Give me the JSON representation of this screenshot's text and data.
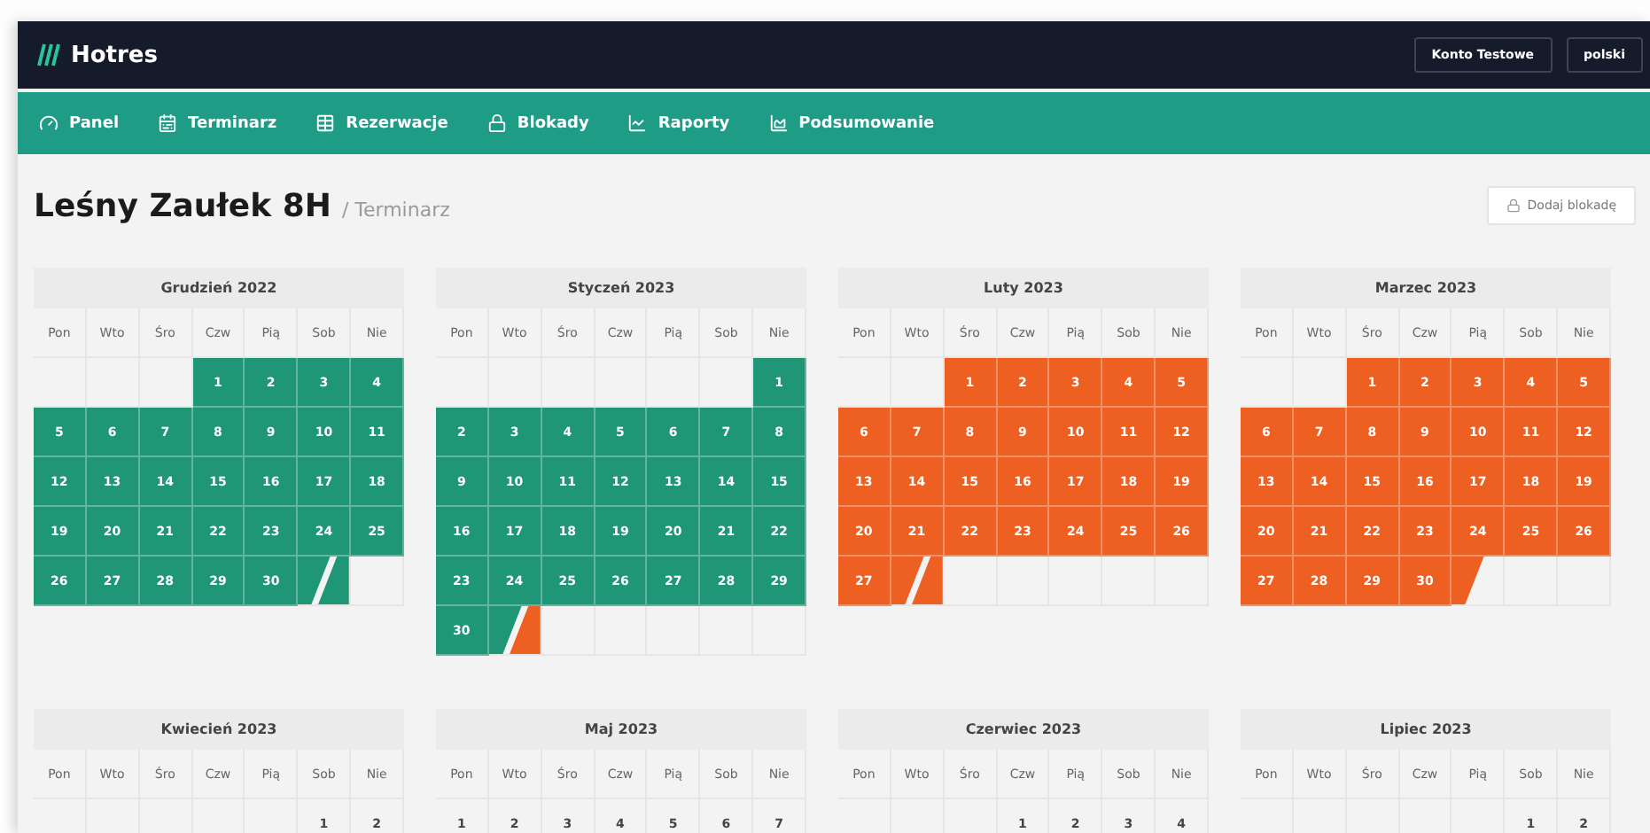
{
  "app": {
    "logo": "Hotres",
    "account_button": "Konto Testowe",
    "language_button": "polski"
  },
  "nav": [
    {
      "label": "Panel"
    },
    {
      "label": "Terminarz"
    },
    {
      "label": "Rezerwacje"
    },
    {
      "label": "Blokady"
    },
    {
      "label": "Raporty"
    },
    {
      "label": "Podsumowanie"
    }
  ],
  "page": {
    "title": "Leśny Zaułek 8H",
    "breadcrumb": "/ Terminarz",
    "add_block_button": "Dodaj blokadę"
  },
  "months": [
    {
      "title": "Grudzień 2022",
      "weekdays": [
        "Pon",
        "Wto",
        "Śro",
        "Czw",
        "Pią",
        "Sob",
        "Nie"
      ],
      "days": [
        {
          "kind": "blank"
        },
        {
          "kind": "blank"
        },
        {
          "kind": "blank"
        },
        {
          "kind": "day",
          "label": "1",
          "color": "#1f9676"
        },
        {
          "kind": "day",
          "label": "2",
          "color": "#1f9676"
        },
        {
          "kind": "day",
          "label": "3",
          "color": "#1f9676"
        },
        {
          "kind": "day",
          "label": "4",
          "color": "#1f9676"
        },
        {
          "kind": "day",
          "label": "5",
          "color": "#1f9676"
        },
        {
          "kind": "day",
          "label": "6",
          "color": "#1f9676"
        },
        {
          "kind": "day",
          "label": "7",
          "color": "#1f9676"
        },
        {
          "kind": "day",
          "label": "8",
          "color": "#1f9676"
        },
        {
          "kind": "day",
          "label": "9",
          "color": "#1f9676"
        },
        {
          "kind": "day",
          "label": "10",
          "color": "#1f9676"
        },
        {
          "kind": "day",
          "label": "11",
          "color": "#1f9676"
        },
        {
          "kind": "day",
          "label": "12",
          "color": "#1f9676"
        },
        {
          "kind": "day",
          "label": "13",
          "color": "#1f9676"
        },
        {
          "kind": "day",
          "label": "14",
          "color": "#1f9676"
        },
        {
          "kind": "day",
          "label": "15",
          "color": "#1f9676"
        },
        {
          "kind": "day",
          "label": "16",
          "color": "#1f9676"
        },
        {
          "kind": "day",
          "label": "17",
          "color": "#1f9676"
        },
        {
          "kind": "day",
          "label": "18",
          "color": "#1f9676"
        },
        {
          "kind": "day",
          "label": "19",
          "color": "#1f9676"
        },
        {
          "kind": "day",
          "label": "20",
          "color": "#1f9676"
        },
        {
          "kind": "day",
          "label": "21",
          "color": "#1f9676"
        },
        {
          "kind": "day",
          "label": "22",
          "color": "#1f9676"
        },
        {
          "kind": "day",
          "label": "23",
          "color": "#1f9676"
        },
        {
          "kind": "day",
          "label": "24",
          "color": "#1f9676"
        },
        {
          "kind": "day",
          "label": "25",
          "color": "#1f9676"
        },
        {
          "kind": "day",
          "label": "26",
          "color": "#1f9676"
        },
        {
          "kind": "day",
          "label": "27",
          "color": "#1f9676"
        },
        {
          "kind": "day",
          "label": "28",
          "color": "#1f9676"
        },
        {
          "kind": "day",
          "label": "29",
          "color": "#1f9676"
        },
        {
          "kind": "day",
          "label": "30",
          "color": "#1f9676"
        },
        {
          "kind": "changeover",
          "halves": [
            {
              "color": "#1f9676"
            },
            {
              "color": "#1f9676"
            }
          ]
        }
      ]
    },
    {
      "title": "Styczeń 2023",
      "weekdays": [
        "Pon",
        "Wto",
        "Śro",
        "Czw",
        "Pią",
        "Sob",
        "Nie"
      ],
      "days": [
        {
          "kind": "blank"
        },
        {
          "kind": "blank"
        },
        {
          "kind": "blank"
        },
        {
          "kind": "blank"
        },
        {
          "kind": "blank"
        },
        {
          "kind": "blank"
        },
        {
          "kind": "day",
          "label": "1",
          "color": "#1f9676"
        },
        {
          "kind": "day",
          "label": "2",
          "color": "#1f9676"
        },
        {
          "kind": "day",
          "label": "3",
          "color": "#1f9676"
        },
        {
          "kind": "day",
          "label": "4",
          "color": "#1f9676"
        },
        {
          "kind": "day",
          "label": "5",
          "color": "#1f9676"
        },
        {
          "kind": "day",
          "label": "6",
          "color": "#1f9676"
        },
        {
          "kind": "day",
          "label": "7",
          "color": "#1f9676"
        },
        {
          "kind": "day",
          "label": "8",
          "color": "#1f9676"
        },
        {
          "kind": "day",
          "label": "9",
          "color": "#1f9676"
        },
        {
          "kind": "day",
          "label": "10",
          "color": "#1f9676"
        },
        {
          "kind": "day",
          "label": "11",
          "color": "#1f9676"
        },
        {
          "kind": "day",
          "label": "12",
          "color": "#1f9676"
        },
        {
          "kind": "day",
          "label": "13",
          "color": "#1f9676"
        },
        {
          "kind": "day",
          "label": "14",
          "color": "#1f9676"
        },
        {
          "kind": "day",
          "label": "15",
          "color": "#1f9676"
        },
        {
          "kind": "day",
          "label": "16",
          "color": "#1f9676"
        },
        {
          "kind": "day",
          "label": "17",
          "color": "#1f9676"
        },
        {
          "kind": "day",
          "label": "18",
          "color": "#1f9676"
        },
        {
          "kind": "day",
          "label": "19",
          "color": "#1f9676"
        },
        {
          "kind": "day",
          "label": "20",
          "color": "#1f9676"
        },
        {
          "kind": "day",
          "label": "21",
          "color": "#1f9676"
        },
        {
          "kind": "day",
          "label": "22",
          "color": "#1f9676"
        },
        {
          "kind": "day",
          "label": "23",
          "color": "#1f9676"
        },
        {
          "kind": "day",
          "label": "24",
          "color": "#1f9676"
        },
        {
          "kind": "day",
          "label": "25",
          "color": "#1f9676"
        },
        {
          "kind": "day",
          "label": "26",
          "color": "#1f9676"
        },
        {
          "kind": "day",
          "label": "27",
          "color": "#1f9676"
        },
        {
          "kind": "day",
          "label": "28",
          "color": "#1f9676"
        },
        {
          "kind": "day",
          "label": "29",
          "color": "#1f9676"
        },
        {
          "kind": "day",
          "label": "30",
          "color": "#1f9676"
        },
        {
          "kind": "changeover",
          "halves": [
            {
              "color": "#1f9676"
            },
            {
              "color": "#ee5f22"
            }
          ]
        }
      ]
    },
    {
      "title": "Luty 2023",
      "weekdays": [
        "Pon",
        "Wto",
        "Śro",
        "Czw",
        "Pią",
        "Sob",
        "Nie"
      ],
      "days": [
        {
          "kind": "blank"
        },
        {
          "kind": "blank"
        },
        {
          "kind": "day",
          "label": "1",
          "color": "#ee5f22"
        },
        {
          "kind": "day",
          "label": "2",
          "color": "#ee5f22"
        },
        {
          "kind": "day",
          "label": "3",
          "color": "#ee5f22"
        },
        {
          "kind": "day",
          "label": "4",
          "color": "#ee5f22"
        },
        {
          "kind": "day",
          "label": "5",
          "color": "#ee5f22"
        },
        {
          "kind": "day",
          "label": "6",
          "color": "#ee5f22"
        },
        {
          "kind": "day",
          "label": "7",
          "color": "#ee5f22"
        },
        {
          "kind": "day",
          "label": "8",
          "color": "#ee5f22"
        },
        {
          "kind": "day",
          "label": "9",
          "color": "#ee5f22"
        },
        {
          "kind": "day",
          "label": "10",
          "color": "#ee5f22"
        },
        {
          "kind": "day",
          "label": "11",
          "color": "#ee5f22"
        },
        {
          "kind": "day",
          "label": "12",
          "color": "#ee5f22"
        },
        {
          "kind": "day",
          "label": "13",
          "color": "#ee5f22"
        },
        {
          "kind": "day",
          "label": "14",
          "color": "#ee5f22"
        },
        {
          "kind": "day",
          "label": "15",
          "color": "#ee5f22"
        },
        {
          "kind": "day",
          "label": "16",
          "color": "#ee5f22"
        },
        {
          "kind": "day",
          "label": "17",
          "color": "#ee5f22"
        },
        {
          "kind": "day",
          "label": "18",
          "color": "#ee5f22"
        },
        {
          "kind": "day",
          "label": "19",
          "color": "#ee5f22"
        },
        {
          "kind": "day",
          "label": "20",
          "color": "#ee5f22"
        },
        {
          "kind": "day",
          "label": "21",
          "color": "#ee5f22"
        },
        {
          "kind": "day",
          "label": "22",
          "color": "#ee5f22"
        },
        {
          "kind": "day",
          "label": "23",
          "color": "#ee5f22"
        },
        {
          "kind": "day",
          "label": "24",
          "color": "#ee5f22"
        },
        {
          "kind": "day",
          "label": "25",
          "color": "#ee5f22"
        },
        {
          "kind": "day",
          "label": "26",
          "color": "#ee5f22"
        },
        {
          "kind": "day",
          "label": "27",
          "color": "#ee5f22"
        },
        {
          "kind": "changeover",
          "halves": [
            {
              "color": "#ee5f22"
            },
            {
              "color": "#ee5f22"
            }
          ]
        }
      ]
    },
    {
      "title": "Marzec 2023",
      "weekdays": [
        "Pon",
        "Wto",
        "Śro",
        "Czw",
        "Pią",
        "Sob",
        "Nie"
      ],
      "days": [
        {
          "kind": "blank"
        },
        {
          "kind": "blank"
        },
        {
          "kind": "day",
          "label": "1",
          "color": "#ee5f22"
        },
        {
          "kind": "day",
          "label": "2",
          "color": "#ee5f22"
        },
        {
          "kind": "day",
          "label": "3",
          "color": "#ee5f22"
        },
        {
          "kind": "day",
          "label": "4",
          "color": "#ee5f22"
        },
        {
          "kind": "day",
          "label": "5",
          "color": "#ee5f22"
        },
        {
          "kind": "day",
          "label": "6",
          "color": "#ee5f22"
        },
        {
          "kind": "day",
          "label": "7",
          "color": "#ee5f22"
        },
        {
          "kind": "day",
          "label": "8",
          "color": "#ee5f22"
        },
        {
          "kind": "day",
          "label": "9",
          "color": "#ee5f22"
        },
        {
          "kind": "day",
          "label": "10",
          "color": "#ee5f22"
        },
        {
          "kind": "day",
          "label": "11",
          "color": "#ee5f22"
        },
        {
          "kind": "day",
          "label": "12",
          "color": "#ee5f22"
        },
        {
          "kind": "day",
          "label": "13",
          "color": "#ee5f22"
        },
        {
          "kind": "day",
          "label": "14",
          "color": "#ee5f22"
        },
        {
          "kind": "day",
          "label": "15",
          "color": "#ee5f22"
        },
        {
          "kind": "day",
          "label": "16",
          "color": "#ee5f22"
        },
        {
          "kind": "day",
          "label": "17",
          "color": "#ee5f22"
        },
        {
          "kind": "day",
          "label": "18",
          "color": "#ee5f22"
        },
        {
          "kind": "day",
          "label": "19",
          "color": "#ee5f22"
        },
        {
          "kind": "day",
          "label": "20",
          "color": "#ee5f22"
        },
        {
          "kind": "day",
          "label": "21",
          "color": "#ee5f22"
        },
        {
          "kind": "day",
          "label": "22",
          "color": "#ee5f22"
        },
        {
          "kind": "day",
          "label": "23",
          "color": "#ee5f22"
        },
        {
          "kind": "day",
          "label": "24",
          "color": "#ee5f22"
        },
        {
          "kind": "day",
          "label": "25",
          "color": "#ee5f22"
        },
        {
          "kind": "day",
          "label": "26",
          "color": "#ee5f22"
        },
        {
          "kind": "day",
          "label": "27",
          "color": "#ee5f22"
        },
        {
          "kind": "day",
          "label": "28",
          "color": "#ee5f22"
        },
        {
          "kind": "day",
          "label": "29",
          "color": "#ee5f22"
        },
        {
          "kind": "day",
          "label": "30",
          "color": "#ee5f22"
        },
        {
          "kind": "changeover",
          "halves": [
            {
              "color": "#ee5f22"
            }
          ]
        }
      ]
    },
    {
      "title": "Kwiecień 2023",
      "weekdays": [
        "Pon",
        "Wto",
        "Śro",
        "Czw",
        "Pią",
        "Sob",
        "Nie"
      ],
      "days": [
        {
          "kind": "blank"
        },
        {
          "kind": "blank"
        },
        {
          "kind": "blank"
        },
        {
          "kind": "blank"
        },
        {
          "kind": "blank"
        },
        {
          "kind": "day",
          "label": "1"
        },
        {
          "kind": "day",
          "label": "2"
        }
      ]
    },
    {
      "title": "Maj 2023",
      "weekdays": [
        "Pon",
        "Wto",
        "Śro",
        "Czw",
        "Pią",
        "Sob",
        "Nie"
      ],
      "days": [
        {
          "kind": "day",
          "label": "1"
        },
        {
          "kind": "day",
          "label": "2"
        },
        {
          "kind": "day",
          "label": "3"
        },
        {
          "kind": "day",
          "label": "4"
        },
        {
          "kind": "day",
          "label": "5"
        },
        {
          "kind": "day",
          "label": "6"
        },
        {
          "kind": "day",
          "label": "7"
        }
      ]
    },
    {
      "title": "Czerwiec 2023",
      "weekdays": [
        "Pon",
        "Wto",
        "Śro",
        "Czw",
        "Pią",
        "Sob",
        "Nie"
      ],
      "days": [
        {
          "kind": "blank"
        },
        {
          "kind": "blank"
        },
        {
          "kind": "blank"
        },
        {
          "kind": "day",
          "label": "1"
        },
        {
          "kind": "day",
          "label": "2"
        },
        {
          "kind": "day",
          "label": "3"
        },
        {
          "kind": "day",
          "label": "4"
        }
      ]
    },
    {
      "title": "Lipiec 2023",
      "weekdays": [
        "Pon",
        "Wto",
        "Śro",
        "Czw",
        "Pią",
        "Sob",
        "Nie"
      ],
      "days": [
        {
          "kind": "blank"
        },
        {
          "kind": "blank"
        },
        {
          "kind": "blank"
        },
        {
          "kind": "blank"
        },
        {
          "kind": "blank"
        },
        {
          "kind": "day",
          "label": "1"
        },
        {
          "kind": "day",
          "label": "2"
        }
      ]
    }
  ]
}
